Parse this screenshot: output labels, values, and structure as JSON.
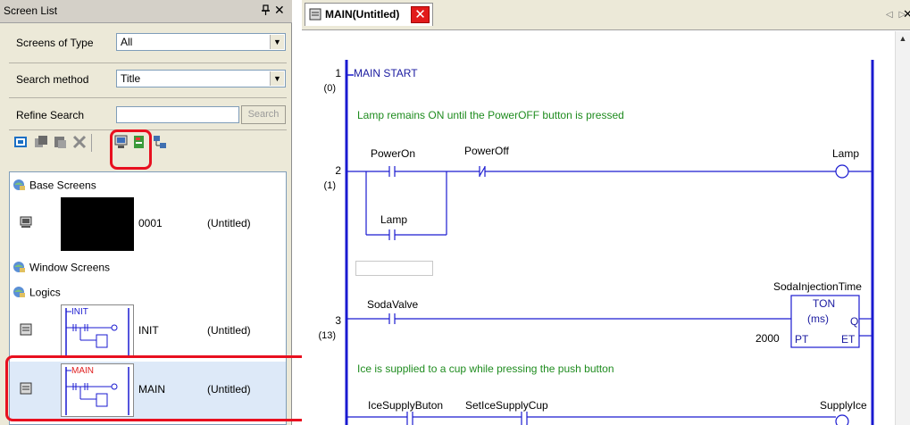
{
  "left_panel": {
    "title": "Screen List",
    "pin": "ₒ",
    "close": "✕",
    "screens_of_type": {
      "label": "Screens of Type",
      "value": "All"
    },
    "search_method": {
      "label": "Search method",
      "value": "Title"
    },
    "refine_search": {
      "label": "Refine Search",
      "placeholder": "",
      "button": "Search"
    },
    "toolbar_icons": [
      "new-screen-icon",
      "copy-screen-icon",
      "paste-screen-icon",
      "delete-icon",
      "show-thumbnail-icon",
      "show-list-icon",
      "sort-icon"
    ],
    "tree": {
      "base_screens": "Base Screens",
      "window_screens": "Window Screens",
      "logics": "Logics",
      "rows": [
        {
          "number": "0001",
          "title": "(Untitled)",
          "thumb_label": ""
        },
        {
          "number": "INIT",
          "title": "(Untitled)",
          "thumb_label": "INIT"
        },
        {
          "number": "MAIN",
          "title": "(Untitled)",
          "thumb_label": "MAIN"
        }
      ]
    }
  },
  "right_panel": {
    "tab_label": "MAIN(Untitled)",
    "tab_close": "✕",
    "arrows": "◁ ▷",
    "close": "✕",
    "ladder": {
      "rung1": {
        "num": "1",
        "step": "(0)",
        "label": "MAIN START"
      },
      "comment1": "Lamp remains ON until the  PowerOFF button is pressed",
      "rung2": {
        "num": "2",
        "step": "(1)",
        "contact1": "PowerOn",
        "contact2": "PowerOff",
        "contact3": "Lamp",
        "coil": "Lamp"
      },
      "rung3": {
        "num": "3",
        "step": "(13)",
        "contact": "SodaValve",
        "timer_name": "SodaInjectionTime",
        "timer_type": "TON",
        "timer_unit": "(ms)",
        "preset": "2000",
        "pt": "PT",
        "q": "Q",
        "et": "ET"
      },
      "comment2": "Ice is supplied to a cup while pressing the push button",
      "rung4": {
        "contact1": "IceSupplyButon",
        "contact2": "SetIceSupplyCup",
        "coil": "SupplyIce"
      }
    }
  },
  "colors": {
    "highlight": "#e8101f",
    "rail": "#1a1ad0",
    "comment": "#1f8c1f",
    "selected_row": "#dde9f8"
  }
}
